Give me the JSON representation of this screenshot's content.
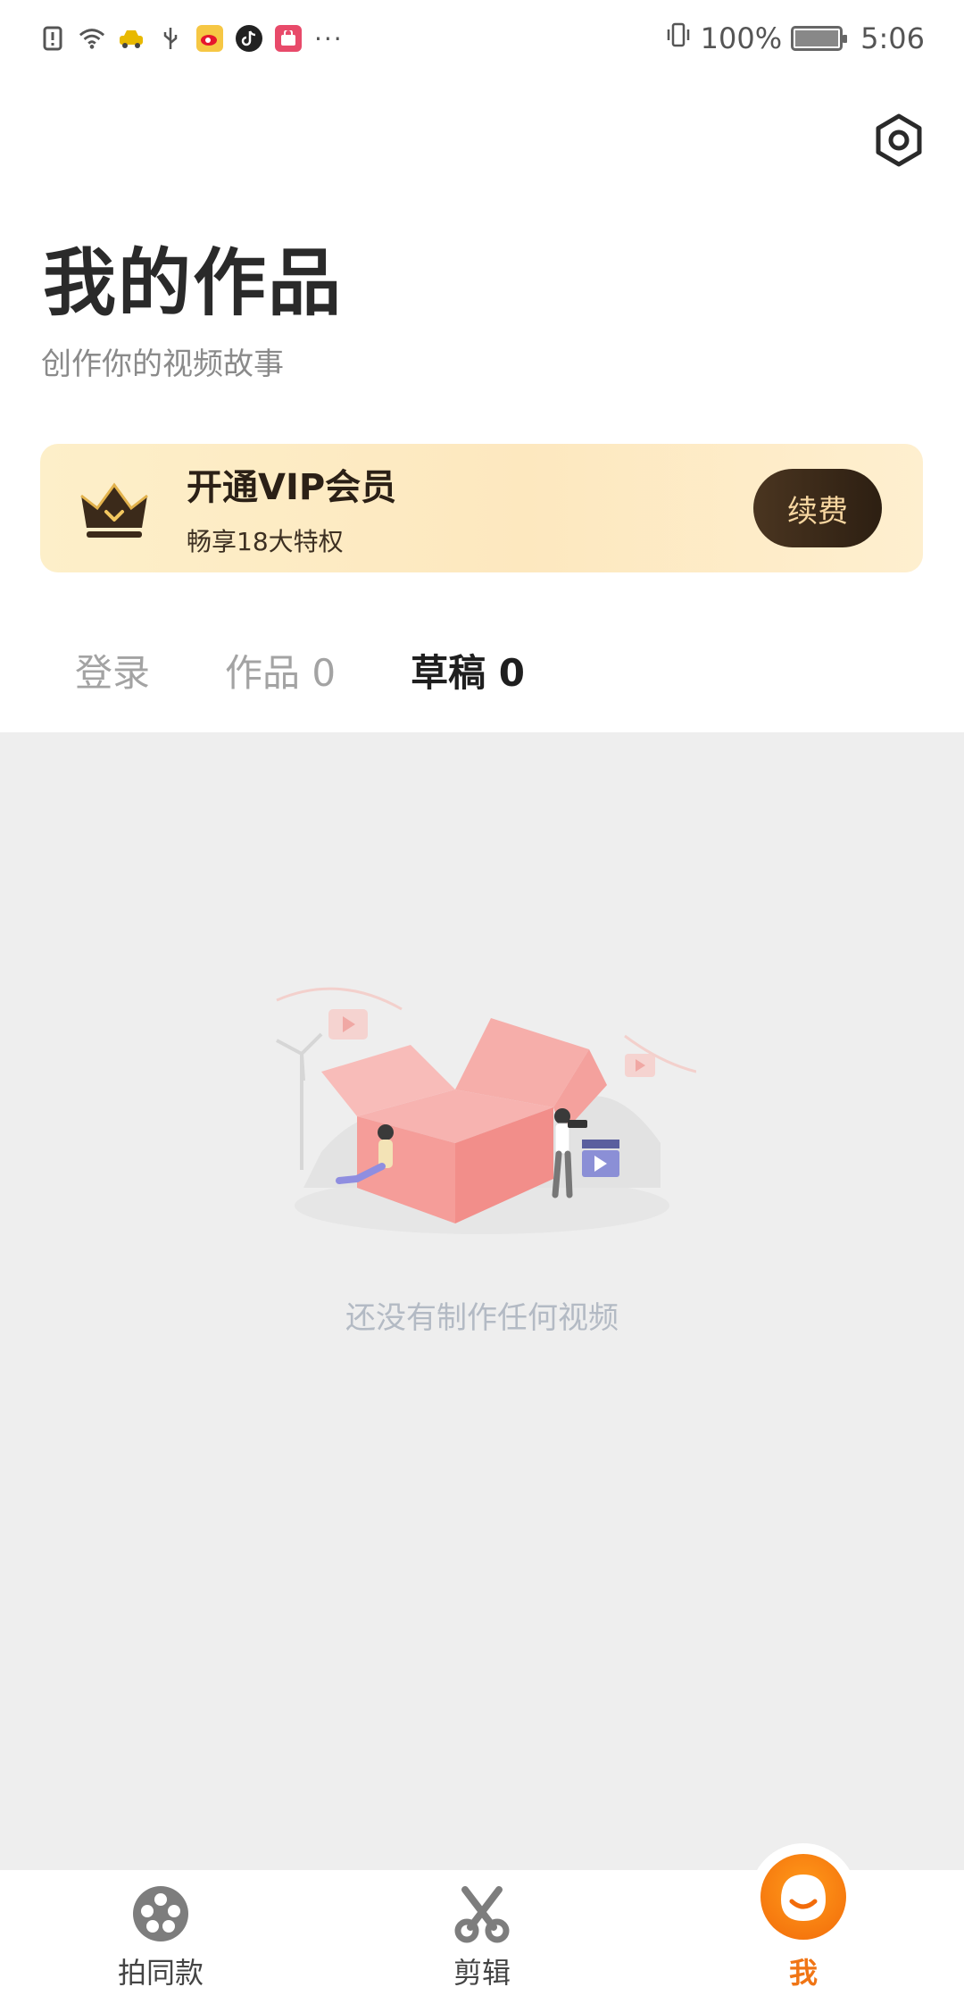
{
  "status_bar": {
    "battery_percent": "100%",
    "time": "5:06",
    "more": "···",
    "icons": [
      "alert-icon",
      "wifi-icon",
      "taxi-app-icon",
      "usb-icon",
      "weibo-app-icon",
      "tiktok-app-icon",
      "shop-app-icon"
    ]
  },
  "header": {
    "title": "我的作品",
    "subtitle": "创作你的视频故事"
  },
  "vip": {
    "title": "开通VIP会员",
    "subtitle": "畅享18大特权",
    "button": "续费"
  },
  "tabs": [
    {
      "label": "登录",
      "active": false
    },
    {
      "label": "作品 0",
      "active": false
    },
    {
      "label": "草稿 0",
      "active": true
    }
  ],
  "empty_state": {
    "text": "还没有制作任何视频"
  },
  "bottom_nav": [
    {
      "label": "拍同款",
      "icon": "film-reel-icon",
      "active": false
    },
    {
      "label": "剪辑",
      "icon": "scissors-icon",
      "active": false
    },
    {
      "label": "我",
      "icon": "profile-face-icon",
      "active": true
    }
  ],
  "colors": {
    "accent": "#f07515",
    "vip_bg": "#fdefc9",
    "vip_button": "#3a2818",
    "content_bg": "#eeeeee"
  }
}
